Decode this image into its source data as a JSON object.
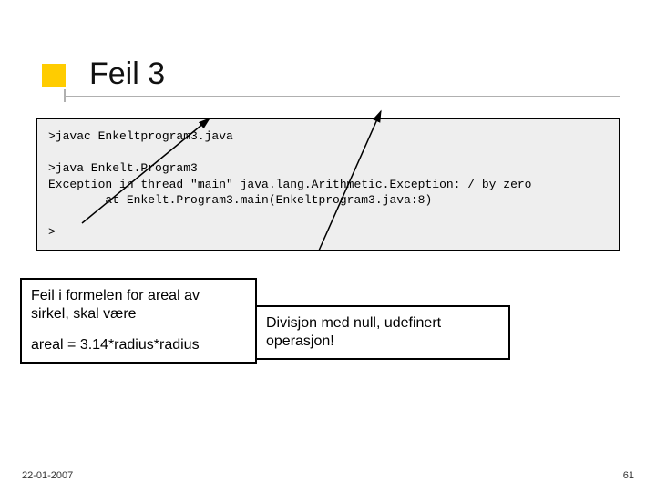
{
  "title": "Feil 3",
  "code": ">javac Enkeltprogram3.java\n\n>java Enkelt.Program3\nException in thread \"main\" java.lang.Arithmetic.Exception: / by zero\n        at Enkelt.Program3.main(Enkeltprogram3.java:8)\n\n>",
  "callout_left_line1": "Feil i formelen for areal av",
  "callout_left_line2": "sirkel, skal være",
  "callout_left_line3": "areal = 3.14*radius*radius",
  "callout_right_line1": "Divisjon med null, udefinert",
  "callout_right_line2": "operasjon!",
  "footer_date": "22-01-2007",
  "footer_page": "61"
}
